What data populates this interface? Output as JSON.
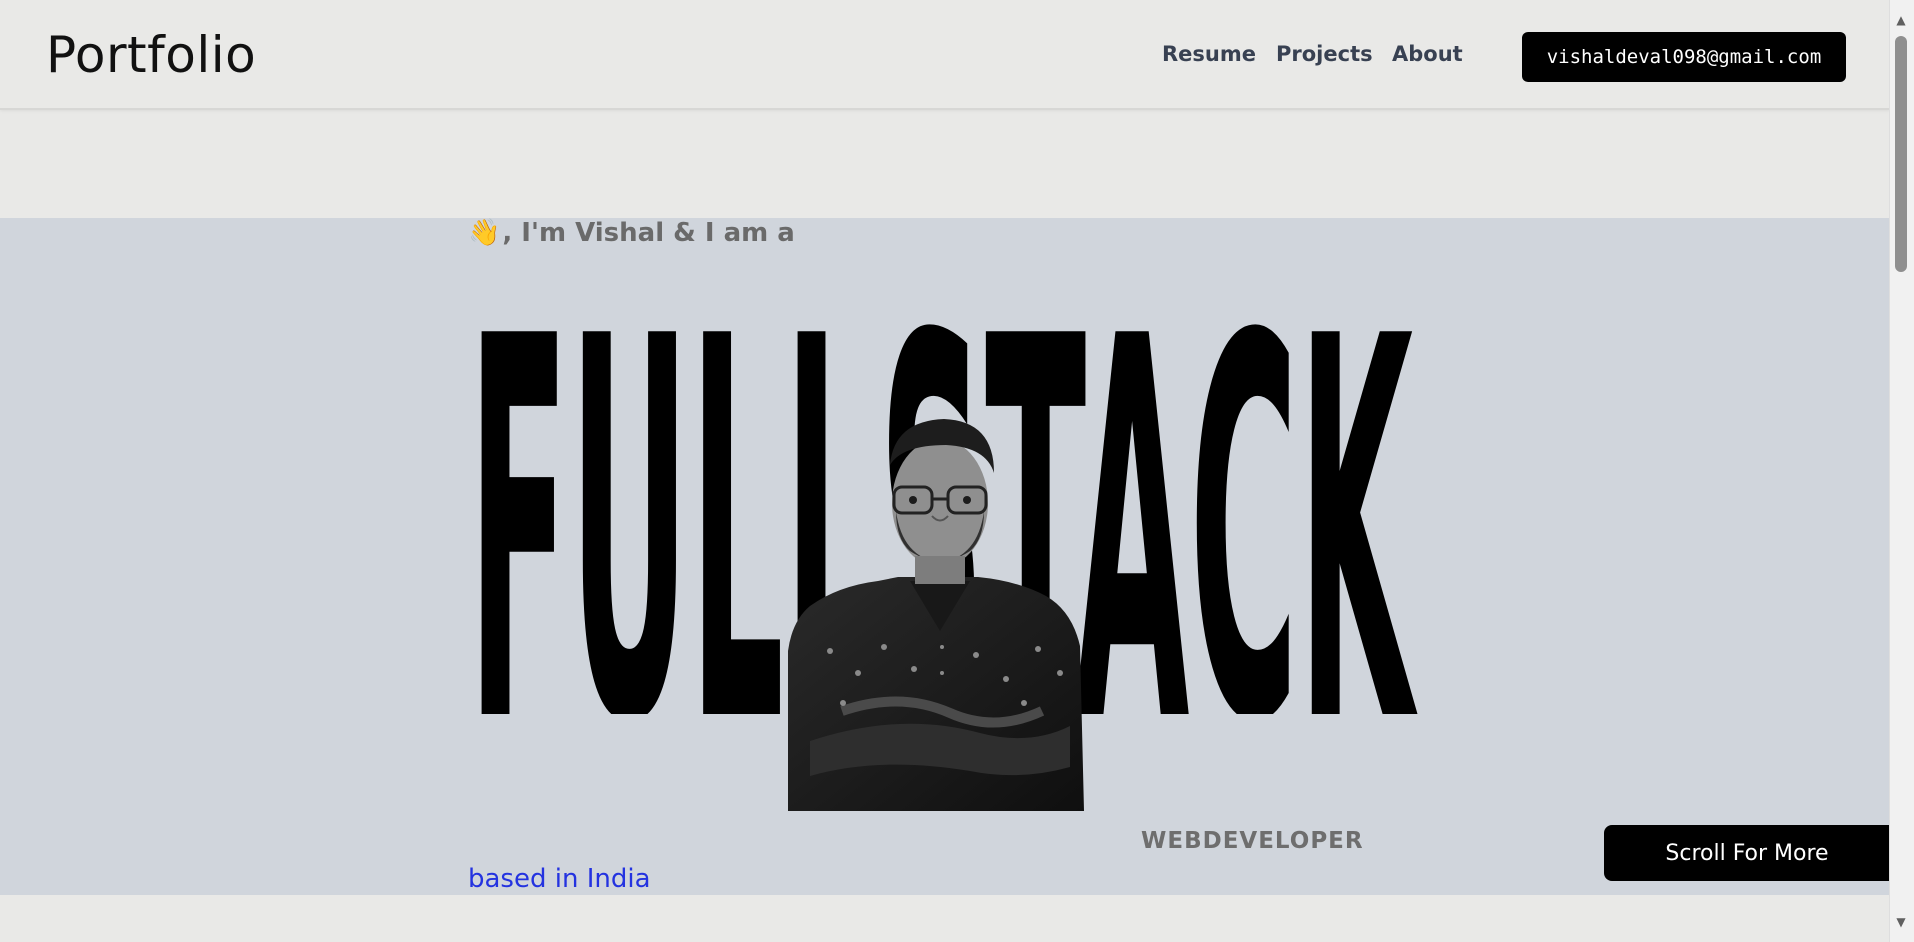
{
  "header": {
    "brand": "Portfolio",
    "nav": {
      "resume": "Resume",
      "projects": "Projects",
      "about": "About"
    },
    "email": "vishaldeval098@gmail.com"
  },
  "hero": {
    "greeting_emoji": "👋",
    "greeting_text": ", I'm Vishal & I am a",
    "headline": "FULLSTACK",
    "role": "WEBDEVELOPER",
    "location": "based in India"
  },
  "cta": {
    "scroll": "Scroll For More"
  },
  "colors": {
    "page_bg": "#e9e9e7",
    "hero_bg": "#d0d5dc",
    "text_dark": "#111111",
    "nav_text": "#384152",
    "accent_blue": "#2433e0",
    "button_bg": "#000000"
  },
  "icons": {
    "scroll_up": "chevron-up-icon",
    "scroll_down": "chevron-down-icon"
  }
}
